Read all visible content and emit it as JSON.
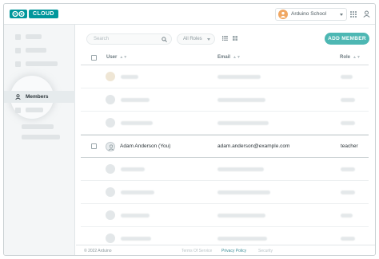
{
  "app": {
    "brand": "CLOUD",
    "organization": "Arduino School"
  },
  "toolbar": {
    "search_placeholder": "Search",
    "roles_value": "All Roles",
    "add_member_label": "ADD MEMBER"
  },
  "sidebar": {
    "active_item": "Members"
  },
  "table": {
    "headers": [
      "User",
      "Email",
      "Role"
    ],
    "visible_row": {
      "user": "Adam Anderson (You)",
      "email": "adam.anderson@example.com",
      "role": "teacher"
    }
  },
  "footer": {
    "copyright": "© 2022 Arduino",
    "terms": "Terms Of Service",
    "privacy": "Privacy Policy",
    "security": "Security"
  },
  "colors": {
    "brand": "#00979c",
    "accent_button": "#4db7b3",
    "org_avatar": "#f0a763"
  },
  "icons": [
    "arduino-logo-icon",
    "user-avatar-icon",
    "apps-grid-icon",
    "account-icon",
    "search-icon",
    "list-view-icon",
    "grid-view-icon",
    "members-icon",
    "chevron-down-icon"
  ]
}
